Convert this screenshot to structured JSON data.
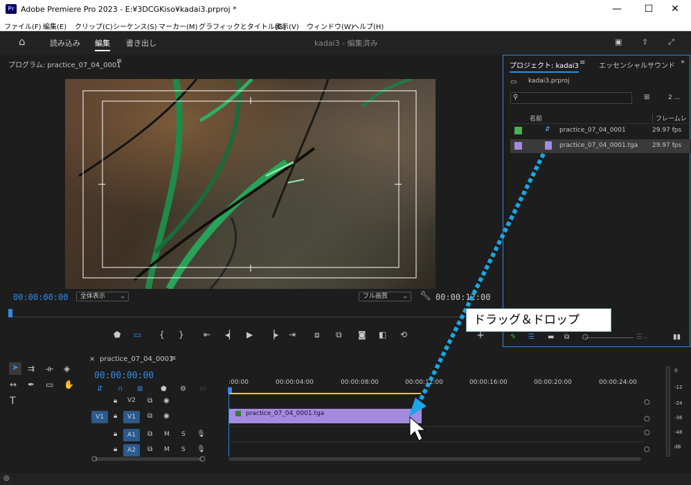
{
  "window": {
    "title": "Adobe Premiere Pro 2023 - E:¥3DCGKiso¥kadai3.prproj *",
    "logo": "Pr",
    "minimize": "—",
    "maximize": "☐",
    "close": "✕"
  },
  "menu": [
    "ファイル(F)",
    "編集(E)",
    "クリップ(C)",
    "シーケンス(S)",
    "マーカー(M)",
    "グラフィックとタイトル(G)",
    "表示(V)",
    "ウィンドウ(W)",
    "ヘルプ(H)"
  ],
  "header": {
    "tabs": [
      "読み込み",
      "編集",
      "書き出し"
    ],
    "active": "編集",
    "center": "kadai3 - 編集済み"
  },
  "program": {
    "title": "プログラム: practice_07_04_0001",
    "timecode": "00:00:00:00",
    "zoom": "全体表示",
    "quality": "フル画質",
    "duration": "00:00:12:00"
  },
  "project": {
    "title": "プロジェクト: kadai3",
    "tab2": "エッセンシャルサウンド",
    "file": "kadai3.prproj",
    "count": "2 ...",
    "col_name": "名前",
    "col_fps": "フレームレ",
    "items": [
      {
        "name": "practice_07_04_0001",
        "fps": "29.97 fps",
        "color": "#4caf50"
      },
      {
        "name": "practice_07_04_0001.tga",
        "fps": "29.97 fps",
        "color": "#a58be0"
      }
    ]
  },
  "timeline": {
    "tab": "practice_07_04_0001",
    "timecode": "00:00:00:00",
    "ruler": [
      ":00:00",
      "00:00:04:00",
      "00:00:08:00",
      "00:00:12:00",
      "00:00:16:00",
      "00:00:20:00",
      "00:00:24:00"
    ],
    "tracks": {
      "v2": "V2",
      "v1": "V1",
      "v1src": "V1",
      "a1": "A1",
      "a2": "A2",
      "m": "M",
      "s": "S"
    },
    "clip": "practice_07_04_0001.tga"
  },
  "meter": [
    "0",
    "-12",
    "-24",
    "-36",
    "-48",
    "dB"
  ],
  "callout": "ドラッグ＆ドロップ",
  "colors": {
    "accent": "#2d8ceb",
    "clip": "#a58be0",
    "arrow": "#1aa7e6"
  }
}
